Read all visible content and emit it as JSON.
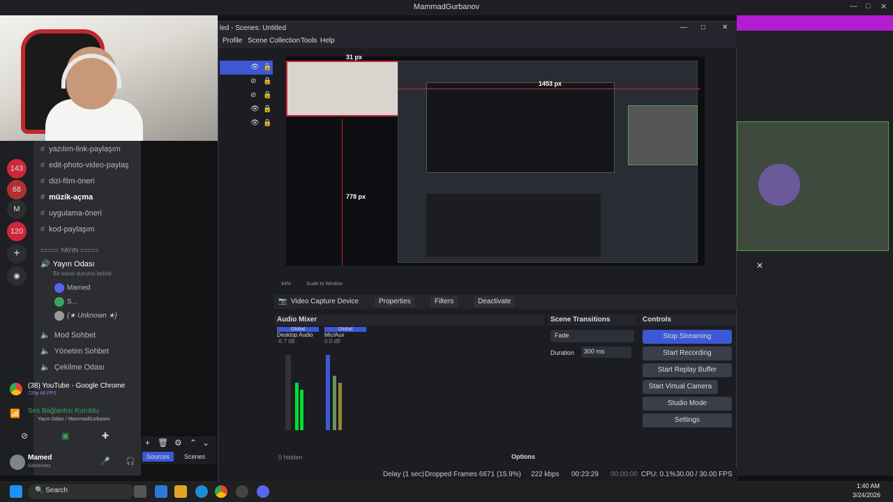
{
  "titlebar": {
    "title": "MammadGurbanov"
  },
  "guilds": [
    {
      "label": "143"
    },
    {
      "label": "68"
    },
    {
      "label": "M"
    },
    {
      "label": "120"
    }
  ],
  "channels": [
    {
      "icon": "#",
      "label": "yazılım-link-paylaşım"
    },
    {
      "icon": "#",
      "label": "edit-photo-video-paylaş"
    },
    {
      "icon": "#",
      "label": "dizi-film-öneri"
    },
    {
      "icon": "#",
      "label": "müzik-açma"
    },
    {
      "icon": "#",
      "label": "uygulama-öneri"
    },
    {
      "icon": "#",
      "label": "kod-paylaşım"
    }
  ],
  "category": {
    "label": "===== YAYIN ====="
  },
  "voice": {
    "name": "Yayın Odası",
    "sub": "Bir kanal durumu belirle"
  },
  "members": [
    {
      "name": "Mamed"
    },
    {
      "name": "S..."
    },
    {
      "name": "{★ Unknown ★}"
    }
  ],
  "voice_channels": [
    {
      "label": "Mod Sohbet"
    },
    {
      "label": "Yönetim Sohbet"
    },
    {
      "label": "Çekilme Odası"
    }
  ],
  "chrome_item": {
    "label": "(38) YouTube - Google Chrome",
    "sub": "720p 60 FPS"
  },
  "voice_status": {
    "label": "Ses Bağlantısı Kuruldu",
    "sub": "Yayın Odası / MammadGurbanov"
  },
  "user": {
    "name": "Mamed",
    "status": "Görünmez"
  },
  "obs": {
    "title": "led - Scenes: Untitled",
    "menu": [
      "Profile",
      "Scene Collection",
      "Tools",
      "Help"
    ],
    "px_labels": {
      "w": "31 px",
      "h": "1453 px",
      "v": "778 px"
    },
    "zoom": "44%",
    "scale": "Scale to Window",
    "source_name": "Video Capture Device",
    "source_buttons": {
      "properties": "Properties",
      "filters": "Filters",
      "deactivate": "Deactivate"
    },
    "audio_mixer": {
      "title": "Audio Mixer",
      "tracks": [
        {
          "scope": "Global",
          "name": "Desktop Audio",
          "db": "-6.7 dB",
          "level": 0.8
        },
        {
          "scope": "Global",
          "name": "Mic/Aux",
          "db": "0.0 dB",
          "level": 0.9
        }
      ],
      "hidden": "0 hidden",
      "options": "Options"
    },
    "scene_transitions": {
      "title": "Scene Transitions",
      "transition": "Fade",
      "duration_label": "Duration",
      "duration": "300 ms"
    },
    "controls": {
      "title": "Controls",
      "buttons": [
        "Stop Streaming",
        "Start Recording",
        "Start Replay Buffer",
        "Start Virtual Camera",
        "Studio Mode",
        "Settings"
      ]
    },
    "dock_tabs": [
      "Sources",
      "Scenes"
    ],
    "status": {
      "delay": "Delay (1 sec)",
      "dropped": "Dropped Frames 6671 (15.9%)",
      "kbps": "222 kbps",
      "stream_time": "00:23:29",
      "rec_time": "00:00:00",
      "cpu": "CPU: 0.1%",
      "fps": "30.00 / 30.00 FPS"
    }
  },
  "taskbar": {
    "search": "Search",
    "time": "1:40 AM",
    "date": "3/24/2026"
  },
  "colors": {
    "accent": "#5865f2",
    "obs_stream": "#3c58d4",
    "discord_bg": "#2b2d31",
    "red": "#d0263a"
  }
}
